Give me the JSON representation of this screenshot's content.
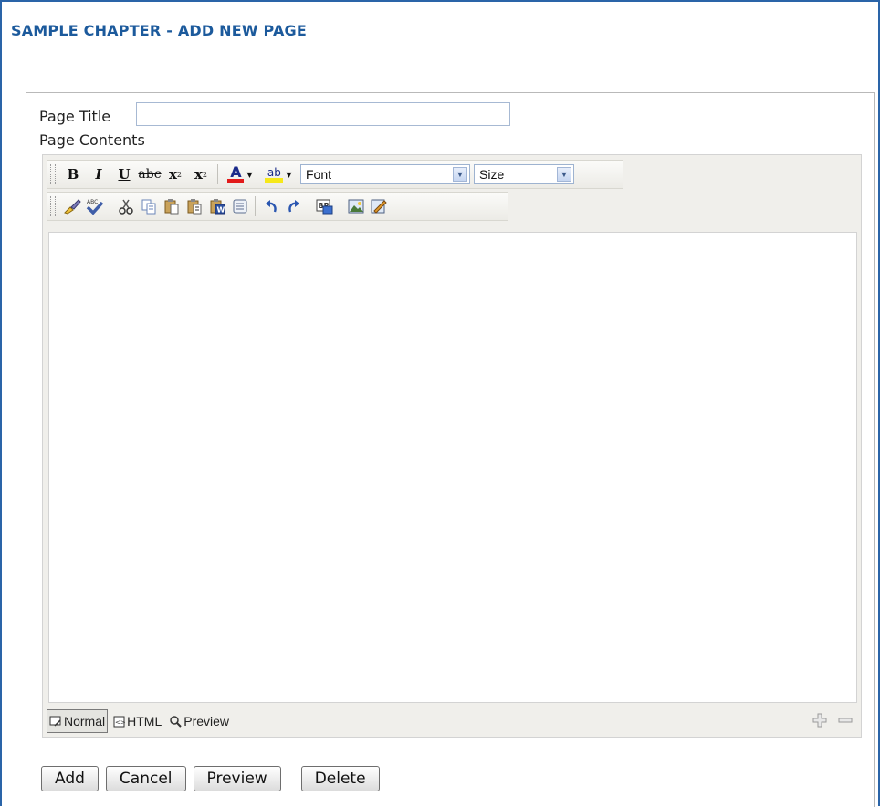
{
  "header": {
    "title": "SAMPLE CHAPTER - ADD NEW PAGE"
  },
  "form": {
    "page_title_label": "Page Title",
    "page_title_value": "",
    "page_contents_label": "Page Contents"
  },
  "toolbar": {
    "bold": "B",
    "italic": "I",
    "underline": "U",
    "strike": "abc",
    "superscript": "x",
    "subscript": "x",
    "font_color": "A",
    "highlight": "ab",
    "font_select": "Font",
    "size_select": "Size"
  },
  "modes": {
    "normal": "Normal",
    "html": "HTML",
    "preview": "Preview"
  },
  "buttons": {
    "add": "Add",
    "cancel": "Cancel",
    "preview": "Preview",
    "delete": "Delete"
  },
  "colors": {
    "header_blue": "#1c5a9c",
    "frame_border": "#2a64a8",
    "font_color_red": "#e21a1a",
    "highlight_yellow": "#f6e81a"
  },
  "icons": {
    "row2": [
      "clean-format-icon",
      "spell-check-icon",
      "cut-icon",
      "copy-icon",
      "paste-icon",
      "paste-text-icon",
      "paste-word-icon",
      "insert-template-icon",
      "undo-icon",
      "redo-icon",
      "insert-break-icon",
      "insert-image-icon",
      "edit-image-icon"
    ]
  }
}
